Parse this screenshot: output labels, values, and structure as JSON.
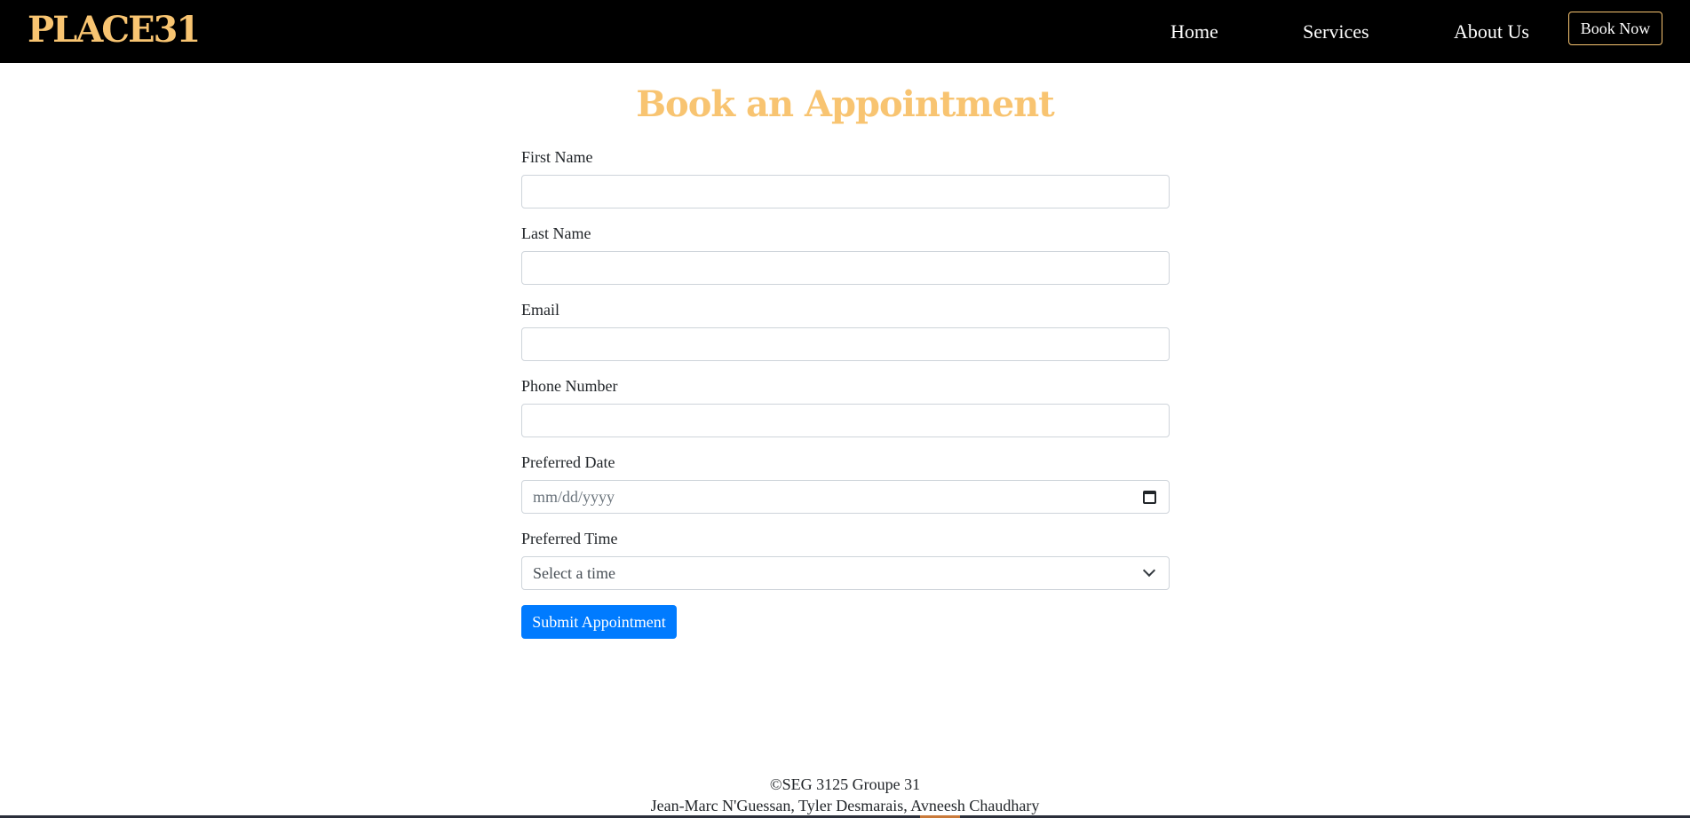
{
  "navbar": {
    "brand": "PLACE31",
    "links": [
      "Home",
      "Services",
      "About Us"
    ],
    "cta": "Book Now"
  },
  "page": {
    "title": "Book an Appointment"
  },
  "form": {
    "first_name": {
      "label": "First Name",
      "value": ""
    },
    "last_name": {
      "label": "Last Name",
      "value": ""
    },
    "email": {
      "label": "Email",
      "value": ""
    },
    "phone": {
      "label": "Phone Number",
      "value": ""
    },
    "date": {
      "label": "Preferred Date",
      "placeholder": "mm/dd/yyyy"
    },
    "time": {
      "label": "Preferred Time",
      "selected": "Select a time"
    },
    "submit": "Submit Appointment"
  },
  "footer": {
    "copyright": "©SEG 3125 Groupe 31",
    "authors": "Jean-Marc N'Guessan, Tyler Desmarais, Avneesh Chaudhary"
  },
  "colors": {
    "accent": "#f8c471",
    "primary_button": "#007bff",
    "navbar_bg": "#000000"
  },
  "icons": [
    "calendar-icon",
    "chevron-down-icon"
  ]
}
